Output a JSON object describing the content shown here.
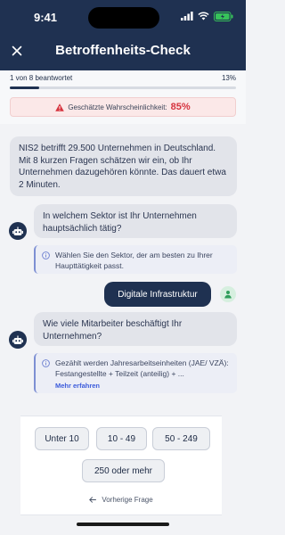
{
  "status_bar": {
    "time": "9:41"
  },
  "header": {
    "title": "Betroffenheits-Check",
    "close_icon": "close-icon"
  },
  "progress": {
    "answered_text": "1 von 8 beantwortet",
    "percent_text": "13%",
    "value": 0.13
  },
  "probability": {
    "label": "Geschätzte Wahrscheinlichkeit:",
    "value": "85%"
  },
  "chat": {
    "intro": "NIS2 betrifft 29.500 Unternehmen in Deutschland. Mit 8 kurzen Fragen schätzen wir ein, ob Ihr Unternehmen dazugehören könnte. Das dauert etwa 2 Minuten.",
    "q1": {
      "text": "In welchem Sektor ist Ihr Unternehmen hauptsächlich tätig?",
      "hint": "Wählen Sie den Sektor, der am besten zu Ihrer Haupttätigkeit passt."
    },
    "answer1": "Digitale Infrastruktur",
    "q2": {
      "text": "Wie viele Mitarbeiter beschäftigt Ihr Unternehmen?",
      "hint": "Gezählt werden Jahresarbeitseinheiten (JAE/ VZÄ): Festangestellte + Teilzeit (anteilig) + ...",
      "more": "Mehr erfahren"
    }
  },
  "options": [
    "Unter 10",
    "10 - 49",
    "50 - 249",
    "250 oder mehr"
  ],
  "previous_question": "Vorherige Frage",
  "colors": {
    "navy": "#1f3151",
    "alert_red": "#d6333e",
    "link_blue": "#3b5bdb"
  }
}
